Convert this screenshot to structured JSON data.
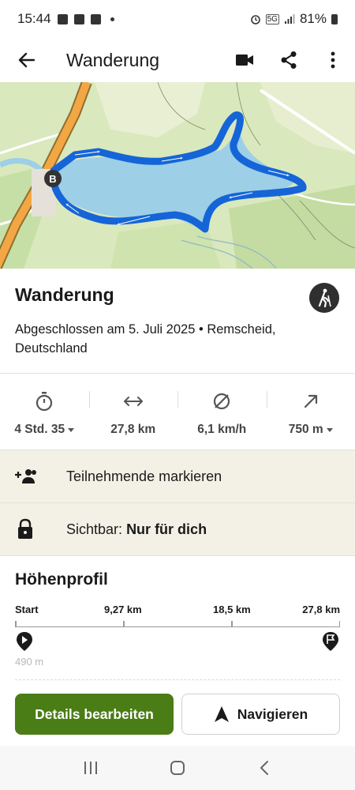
{
  "status_bar": {
    "time": "15:44",
    "battery": "81%"
  },
  "app_bar": {
    "title": "Wanderung"
  },
  "map": {
    "start_marker_label": "B"
  },
  "activity": {
    "title": "Wanderung",
    "subtitle": "Abgeschlossen am 5. Juli 2025 • Remscheid, Deutschland"
  },
  "stats": [
    {
      "icon": "stopwatch-icon",
      "value": "4 Std. 35",
      "dropdown": true
    },
    {
      "icon": "distance-icon",
      "value": "27,8 km",
      "dropdown": false
    },
    {
      "icon": "average-speed-icon",
      "value": "6,1 km/h",
      "dropdown": false
    },
    {
      "icon": "elevation-icon",
      "value": "750 m",
      "dropdown": true
    }
  ],
  "participants": {
    "label": "Teilnehmende markieren"
  },
  "visibility": {
    "prefix": "Sichtbar:",
    "value": "Nur für dich"
  },
  "elevation_profile": {
    "title": "Höhenprofil",
    "axis_labels": [
      "Start",
      "9,27 km",
      "18,5 km",
      "27,8 km"
    ],
    "y_label": "490 m"
  },
  "actions": {
    "edit_label": "Details bearbeiten",
    "navigate_label": "Navigieren"
  },
  "colors": {
    "accent": "#4a7d15",
    "route": "#1565d8",
    "lake": "#9dcfe6",
    "row_bg": "#f3f1e6"
  }
}
